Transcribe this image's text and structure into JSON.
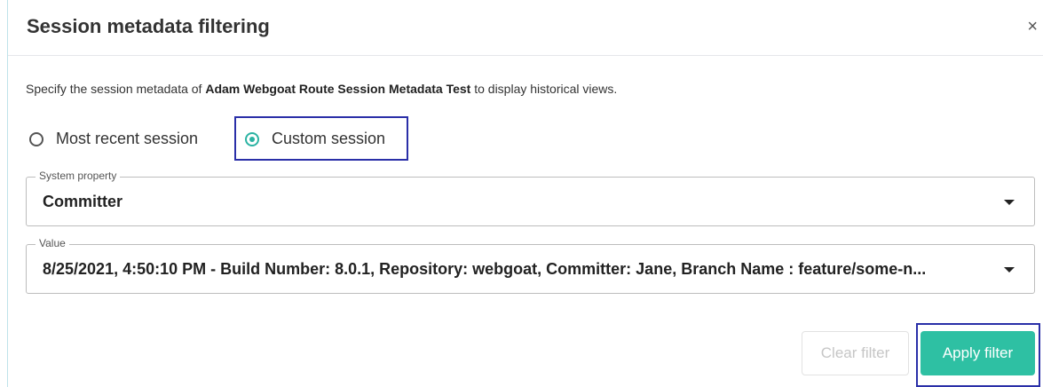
{
  "dialog": {
    "title": "Session metadata filtering",
    "close_glyph": "×"
  },
  "description": {
    "prefix": "Specify the session metadata of ",
    "app_name": "Adam Webgoat Route Session Metadata Test",
    "suffix": " to display historical views."
  },
  "session_options": [
    {
      "label": "Most recent session",
      "selected": false
    },
    {
      "label": "Custom session",
      "selected": true
    }
  ],
  "system_property": {
    "label": "System property",
    "value": "Committer"
  },
  "value_field": {
    "label": "Value",
    "value": "8/25/2021, 4:50:10 PM - Build Number: 8.0.1, Repository: webgoat, Committer: Jane, Branch Name : feature/some-n..."
  },
  "buttons": {
    "clear": "Clear filter",
    "apply": "Apply filter"
  },
  "colors": {
    "accent": "#2ec0a3",
    "focus_outline": "#2a2fa8"
  }
}
